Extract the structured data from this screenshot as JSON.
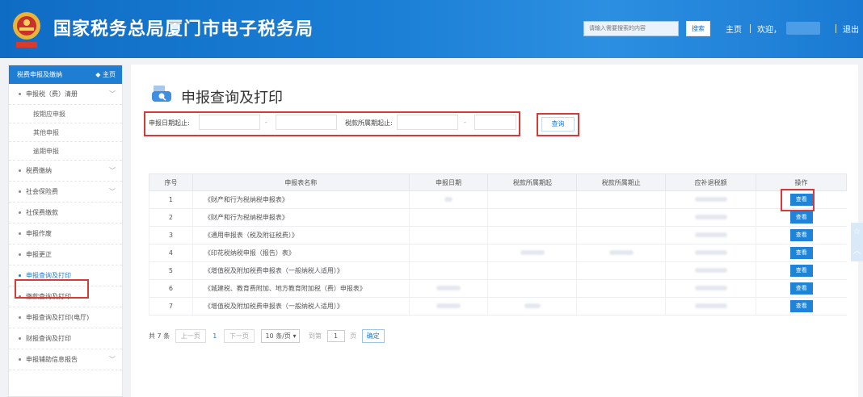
{
  "header": {
    "title": "国家税务总局厦门市电子税务局",
    "search_placeholder": "请输入需要搜索的内容",
    "search_label": "搜索",
    "home_label": "主页",
    "welcome_label": "欢迎，",
    "logout_label": "退出"
  },
  "sidebar": {
    "header_label": "税费申报及缴纳",
    "home_label": "主页",
    "items": [
      {
        "label": "申报税（费）清册",
        "expandable": true
      },
      {
        "label": "按期应申报"
      },
      {
        "label": "其他申报"
      },
      {
        "label": "逾期申报"
      },
      {
        "label": "税费缴纳",
        "expandable": true
      },
      {
        "label": "社会保险费",
        "expandable": true
      },
      {
        "label": "社保费缴款"
      },
      {
        "label": "申报作废"
      },
      {
        "label": "申报更正"
      },
      {
        "label": "申报查询及打印",
        "active": true
      },
      {
        "label": "缴款查询及打印"
      },
      {
        "label": "申报查询及打印(电厅)"
      },
      {
        "label": "财报查询及打印"
      },
      {
        "label": "申报辅助信息报告",
        "expandable": true
      }
    ]
  },
  "main": {
    "page_title": "申报查询及打印",
    "filter": {
      "declare_date_label": "申报日期起止:",
      "tax_period_label": "税款所属期起止:",
      "sep": "-",
      "query_label": "查询"
    },
    "table": {
      "headers": [
        "序号",
        "申报表名称",
        "申报日期",
        "税款所属期起",
        "税款所属期止",
        "应补退税额",
        "操作"
      ],
      "rows": [
        {
          "no": "1",
          "name": "《财产和行为税纳税申报表》",
          "action": "查看"
        },
        {
          "no": "2",
          "name": "《财产和行为税纳税申报表》",
          "action": "查看"
        },
        {
          "no": "3",
          "name": "《通用申报表（税及附征税费）》",
          "action": "查看"
        },
        {
          "no": "4",
          "name": "《印花税纳税申报（报告）表》",
          "action": "查看"
        },
        {
          "no": "5",
          "name": "《增值税及附加税费申报表（一般纳税人适用）》",
          "action": "查看"
        },
        {
          "no": "6",
          "name": "《城建税、教育费附加、地方教育附加税（费）申报表》",
          "action": "查看"
        },
        {
          "no": "7",
          "name": "《增值税及附加税费申报表（一般纳税人适用）》",
          "action": "查看"
        }
      ]
    },
    "pager": {
      "total": "共 7 条",
      "prev": "上一页",
      "page": "1",
      "next": "下一页",
      "page_size": "10 条/页",
      "goto_label": "到第",
      "goto_value": "1",
      "page_unit": "页",
      "confirm": "确定"
    }
  },
  "colors": {
    "header_blue": "#1b7fd6",
    "accent": "#1d7ed4",
    "highlight_red": "#d43c3c"
  },
  "icons": [
    "emblem-icon",
    "home-icon",
    "chevron-down-icon",
    "print-search-icon",
    "caret-down-icon",
    "star-icon",
    "back-to-top-icon"
  ]
}
